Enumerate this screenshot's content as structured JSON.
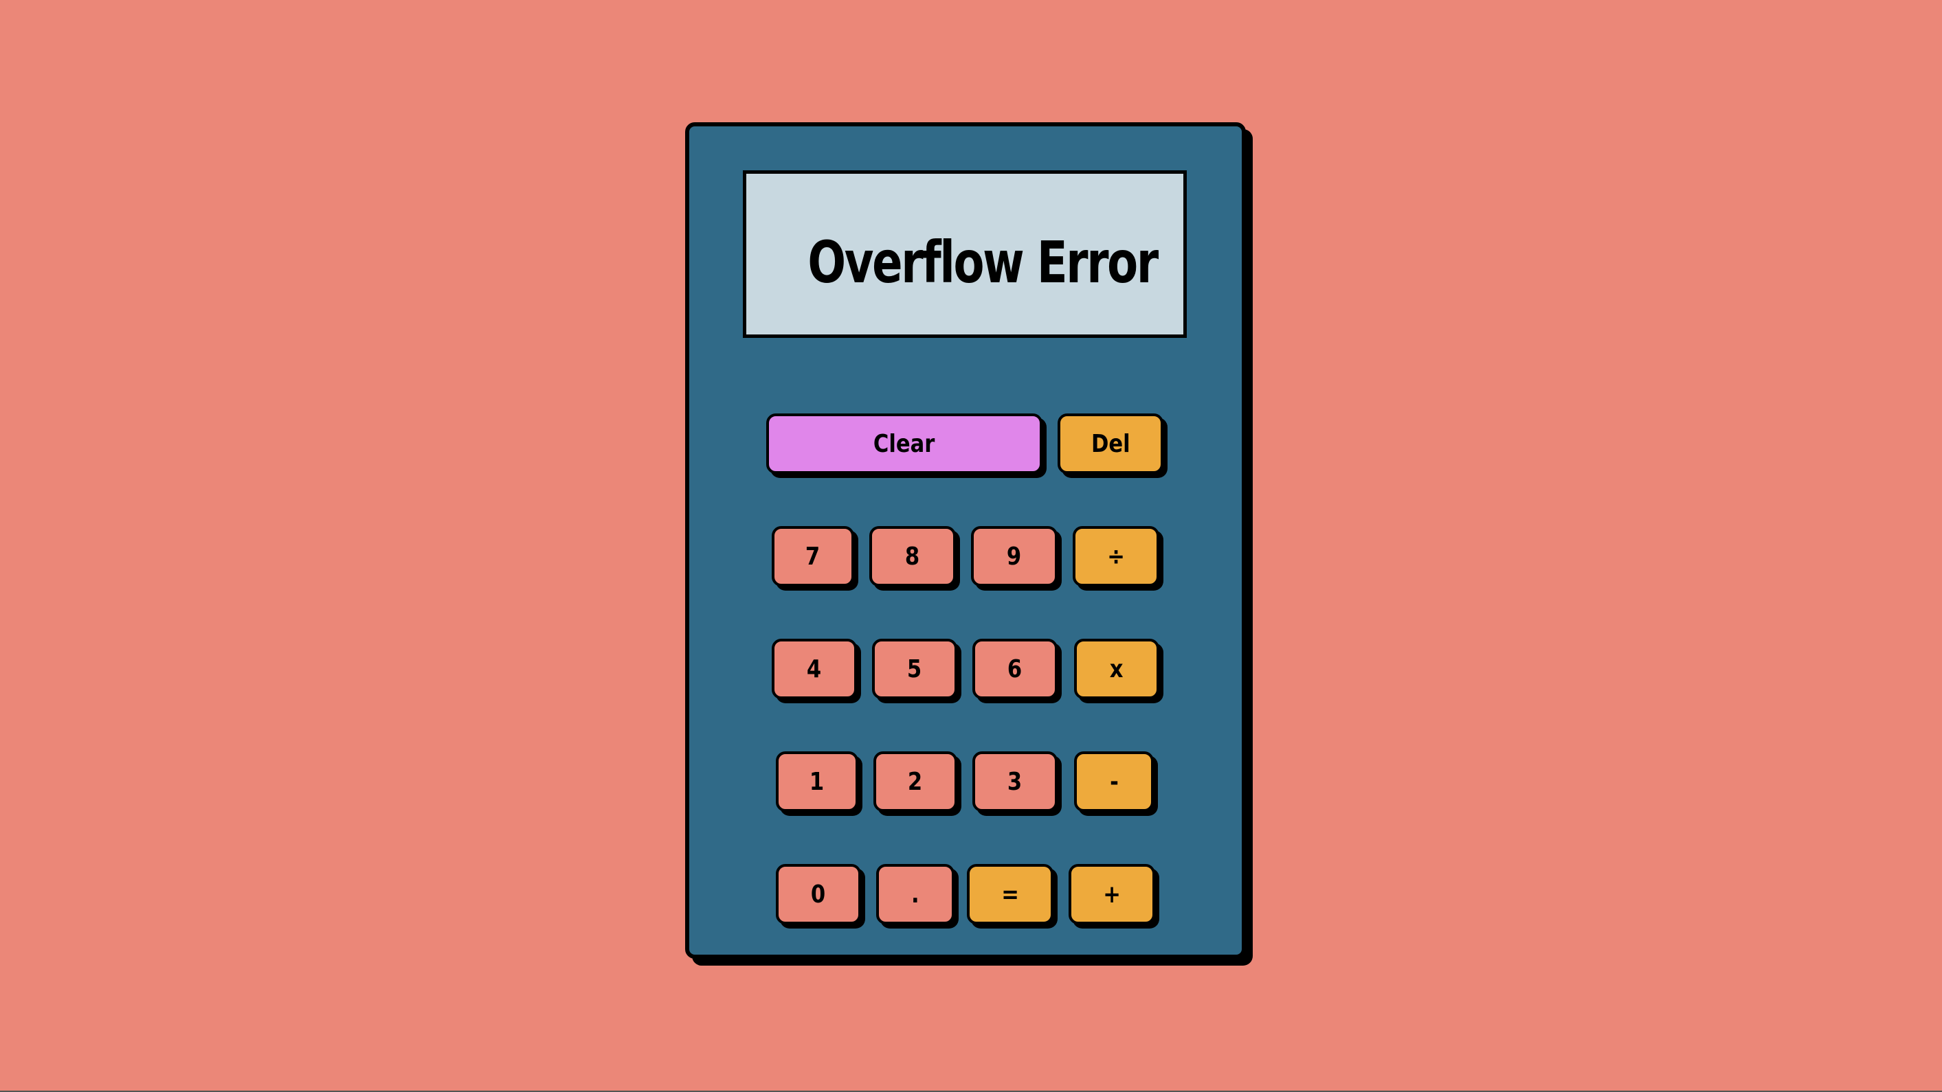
{
  "display": {
    "text": "Overflow Error"
  },
  "keys": {
    "clear": "Clear",
    "del": "Del",
    "seven": "7",
    "eight": "8",
    "nine": "9",
    "divide": "÷",
    "four": "4",
    "five": "5",
    "six": "6",
    "multiply": "x",
    "one": "1",
    "two": "2",
    "three": "3",
    "subtract": "-",
    "zero": "0",
    "decimal": ".",
    "equals": "=",
    "add": "+"
  },
  "colors": {
    "background": "#EB8778",
    "body": "#306A88",
    "display": "#C8D8E0",
    "number_key": "#EB8778",
    "operator_key": "#EEAA3C",
    "clear_key": "#E086EA"
  }
}
